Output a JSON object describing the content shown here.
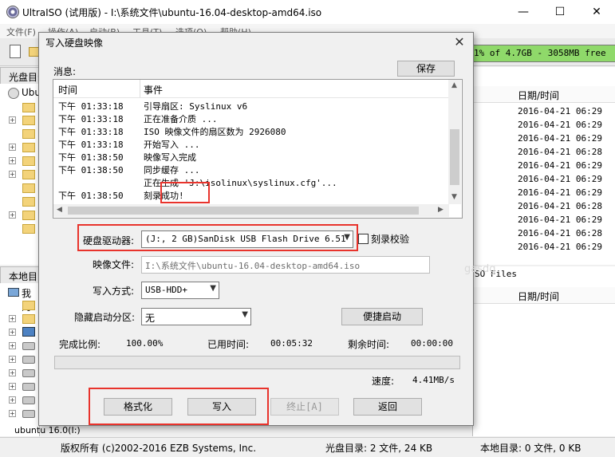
{
  "window": {
    "title": "UltraISO (试用版) - I:\\系统文件\\ubuntu-16.04-desktop-amd64.iso",
    "minimize": "—",
    "maximize": "☐",
    "close": "✕"
  },
  "menubar": [
    "文件(F)",
    "操作(A)",
    "启动(B)",
    "工具(T)",
    "选项(O)",
    "帮助(H)"
  ],
  "capacity": {
    "text": "1% of 4.7GB - 3058MB free",
    "color": "#8fd96a"
  },
  "left_top_pane": {
    "header": "光盘目录",
    "root": "Ubun"
  },
  "left_bottom_pane": {
    "header": "本地目",
    "root": "我的",
    "last_item": "ubuntu 16.0(I:)"
  },
  "right_top_pane": {
    "column": "日期/时间",
    "dates": [
      "2016-04-21 06:29",
      "2016-04-21 06:29",
      "2016-04-21 06:29",
      "2016-04-21 06:28",
      "2016-04-21 06:29",
      "2016-04-21 06:29",
      "2016-04-21 06:29",
      "2016-04-21 06:28",
      "2016-04-21 06:29",
      "2016-04-21 06:28",
      "2016-04-21 06:29"
    ]
  },
  "right_bottom_pane": {
    "path": "SO Files",
    "column": "日期/时间"
  },
  "statusbar": {
    "copyright": "版权所有 (c)2002-2016 EZB Systems, Inc.",
    "disc_dir": "光盘目录: 2 文件, 24 KB",
    "local_dir": "本地目录: 0 文件, 0 KB"
  },
  "dialog": {
    "title": "写入硬盘映像",
    "close": "✕",
    "message_label": "消息:",
    "save_button": "保存",
    "log": {
      "col_time": "时间",
      "col_event": "事件",
      "rows": [
        {
          "time": "下午 01:33:18",
          "event": "引导扇区: Syslinux v6"
        },
        {
          "time": "下午 01:33:18",
          "event": "正在准备介质 ..."
        },
        {
          "time": "下午 01:33:18",
          "event": "ISO 映像文件的扇区数为 2926080"
        },
        {
          "time": "下午 01:33:18",
          "event": "开始写入 ..."
        },
        {
          "time": "下午 01:38:50",
          "event": "映像写入完成"
        },
        {
          "time": "下午 01:38:50",
          "event": "同步缓存 ..."
        },
        {
          "time": "",
          "event": "正在生成 'J:\\isolinux\\syslinux.cfg'..."
        },
        {
          "time": "下午 01:38:50",
          "event": "刻录成功!"
        }
      ]
    },
    "drive_label": "硬盘驱动器:",
    "drive_value": "(J:, 2 GB)SanDisk USB Flash Drive 6.51",
    "verify_label": "刻录校验",
    "image_label": "映像文件:",
    "image_value": "I:\\系统文件\\ubuntu-16.04-desktop-amd64.iso",
    "write_mode_label": "写入方式:",
    "write_mode_value": "USB-HDD+",
    "hide_label": "隐藏启动分区:",
    "hide_value": "无",
    "easy_boot_button": "便捷启动",
    "progress_label": "完成比例:",
    "progress_value": "100.00%",
    "progress_fraction": 1.0,
    "elapsed_label": "已用时间:",
    "elapsed_value": "00:05:32",
    "remaining_label": "剩余时间:",
    "remaining_value": "00:00:00",
    "speed_label": "速度:",
    "speed_value": "4.41MB/s",
    "format_button": "格式化",
    "write_button": "写入",
    "stop_button": "终止[A]",
    "back_button": "返回",
    "watermark": "gasdg"
  }
}
